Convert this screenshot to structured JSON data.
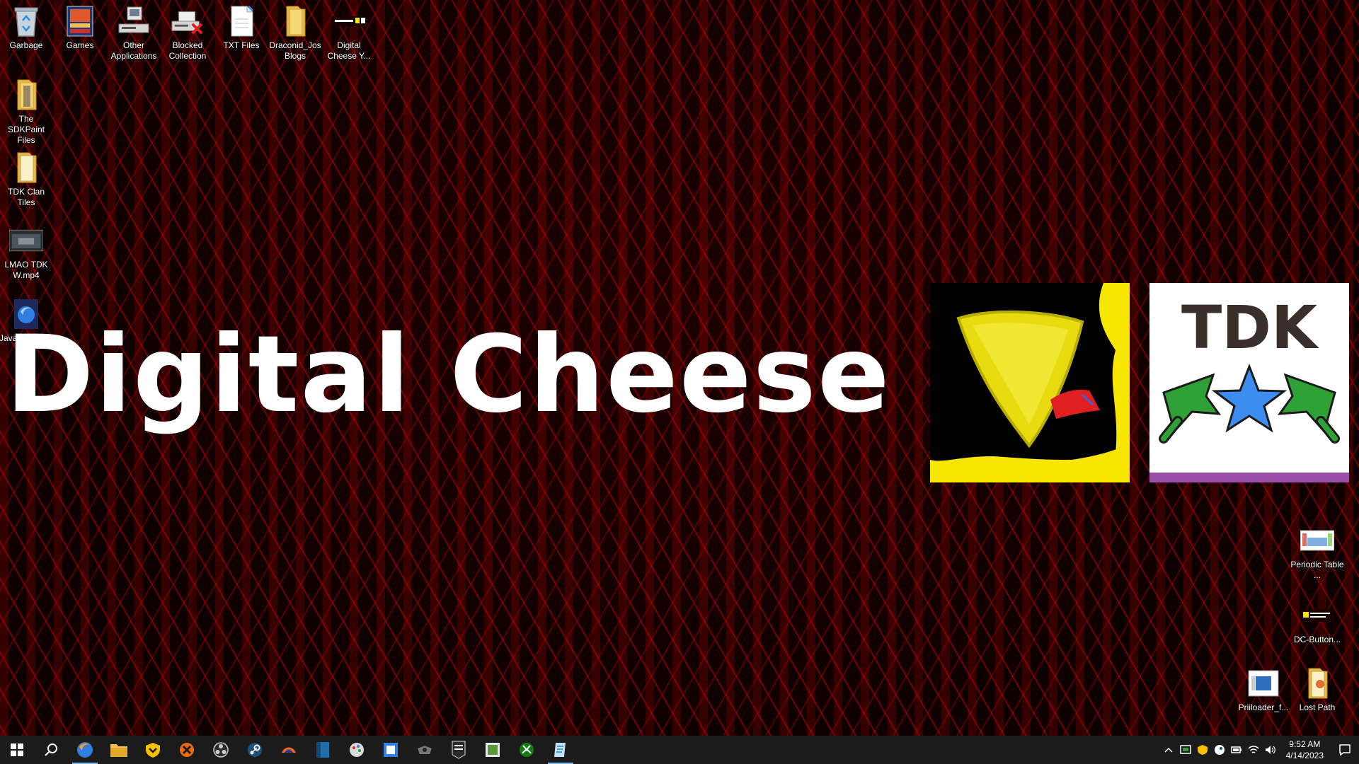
{
  "desktop": {
    "icons": [
      {
        "label": "Garbage"
      },
      {
        "label": "Games"
      },
      {
        "label": "Other Applications"
      },
      {
        "label": "Blocked Collection"
      },
      {
        "label": "TXT Files"
      },
      {
        "label": "Draconid_Jos Blogs"
      },
      {
        "label": "Digital Cheese Y..."
      },
      {
        "label": "The SDKPaint Files"
      },
      {
        "label": "TDK Clan Tiles"
      },
      {
        "label": "LMAO TDK W.mp4"
      },
      {
        "label": "Javascript.svg"
      },
      {
        "label": "Periodic Table ..."
      },
      {
        "label": "DC-Button..."
      },
      {
        "label": "Priiloader_f..."
      },
      {
        "label": "Lost Path"
      }
    ]
  },
  "wallpaper": {
    "title": "Digital Cheese",
    "tdk_logo_text": "TDK"
  },
  "taskbar": {
    "apps": [
      "start-icon",
      "search-icon",
      "firefox-icon",
      "file-explorer-icon",
      "shield-icon",
      "x-app-icon",
      "obs-icon",
      "steam-icon",
      "origin-icon",
      "blue-bar-icon",
      "paint-icon",
      "box-app-icon",
      "game-controller-icon",
      "epic-games-icon",
      "minecraft-icon",
      "xbox-icon",
      "notepad-icon"
    ]
  },
  "clock": {
    "time": "9:52 AM",
    "date": "4/14/2023"
  },
  "colors": {
    "taskbar_bg": "#1b1b1b",
    "accent_underline": "#77b7e8",
    "cheese_yellow": "#f7e600",
    "tdk_green": "#2f9a2f",
    "tdk_blue": "#3d8cf2",
    "tdk_purple": "#9b4fa8"
  }
}
